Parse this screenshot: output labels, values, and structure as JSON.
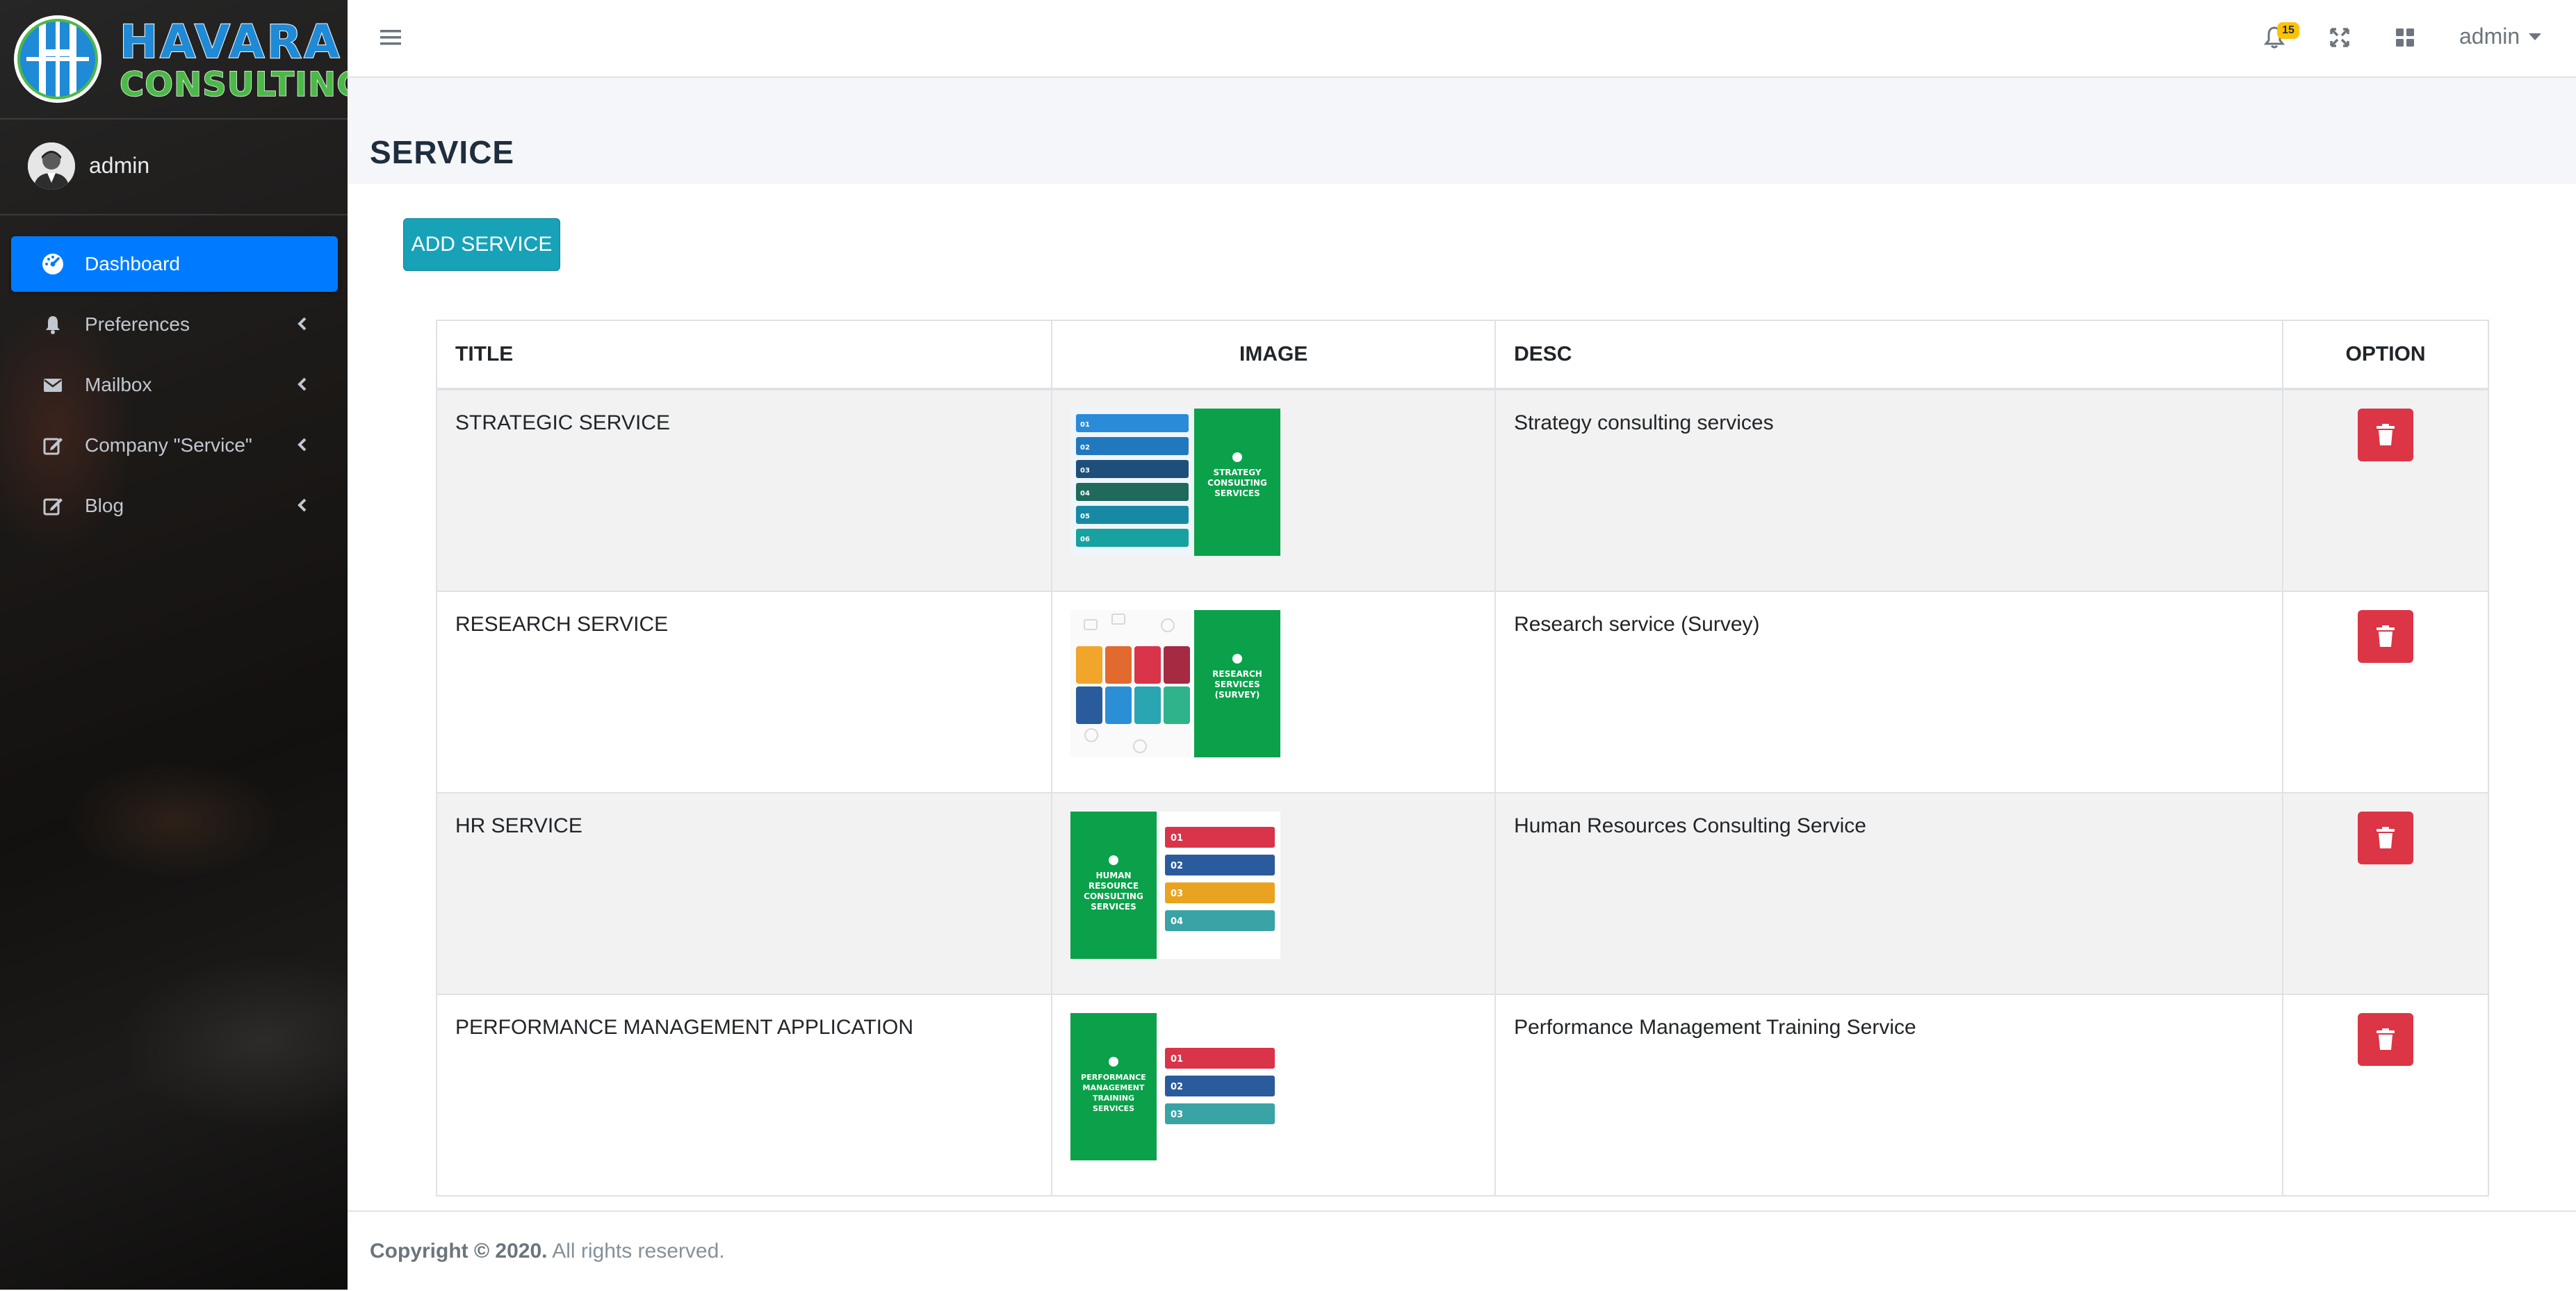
{
  "brand": {
    "line1": "HAVARA",
    "line2": "CONSULTING"
  },
  "user": {
    "name": "admin"
  },
  "nav": {
    "items": [
      {
        "label": "Dashboard",
        "icon": "tachometer-icon",
        "active": true
      },
      {
        "label": "Preferences",
        "icon": "bell-icon",
        "active": false
      },
      {
        "label": "Mailbox",
        "icon": "envelope-icon",
        "active": false
      },
      {
        "label": "Company \"Service\"",
        "icon": "edit-icon",
        "active": false
      },
      {
        "label": "Blog",
        "icon": "edit-icon",
        "active": false
      }
    ]
  },
  "topbar": {
    "notification_count": "15",
    "user_menu_label": "admin",
    "icons": [
      "menu-icon",
      "bell-icon",
      "expand-icon",
      "grid-icon",
      "caret-down-icon"
    ]
  },
  "page": {
    "title": "SERVICE",
    "add_button_label": "ADD SERVICE"
  },
  "table": {
    "headers": [
      "TITLE",
      "IMAGE",
      "DESC",
      "OPTION"
    ],
    "rows": [
      {
        "title": "STRATEGIC SERVICE",
        "desc": "Strategy consulting services",
        "image_caption": [
          "STRATEGY",
          "CONSULTING",
          "SERVICES"
        ],
        "image_numbers": [
          "01",
          "02",
          "03",
          "04",
          "05",
          "06"
        ]
      },
      {
        "title": "RESEARCH SERVICE",
        "desc": "Research service (Survey)",
        "image_caption": [
          "RESEARCH",
          "SERVICES",
          "(SURVEY)"
        ]
      },
      {
        "title": "HR SERVICE",
        "desc": "Human Resources Consulting Service",
        "image_caption": [
          "HUMAN",
          "RESOURCE",
          "CONSULTING",
          "SERVICES"
        ],
        "image_numbers": [
          "01",
          "02",
          "03",
          "04"
        ]
      },
      {
        "title": "PERFORMANCE MANAGEMENT APPLICATION",
        "desc": "Performance Management Training Service",
        "image_caption": [
          "PERFORMANCE",
          "MANAGEMENT",
          "TRAINING",
          "SERVICES"
        ],
        "image_numbers": [
          "01",
          "02",
          "03"
        ]
      }
    ]
  },
  "footer": {
    "copyright": "Copyright © 2020.",
    "rights": "All rights reserved."
  },
  "colors": {
    "primary": "#007bff",
    "info": "#17a2b8",
    "danger": "#dc3545",
    "warning": "#ffc107",
    "brand_blue": "#1f8ad6",
    "brand_green": "#4cb848",
    "thumb_green": "#0aa14a"
  }
}
